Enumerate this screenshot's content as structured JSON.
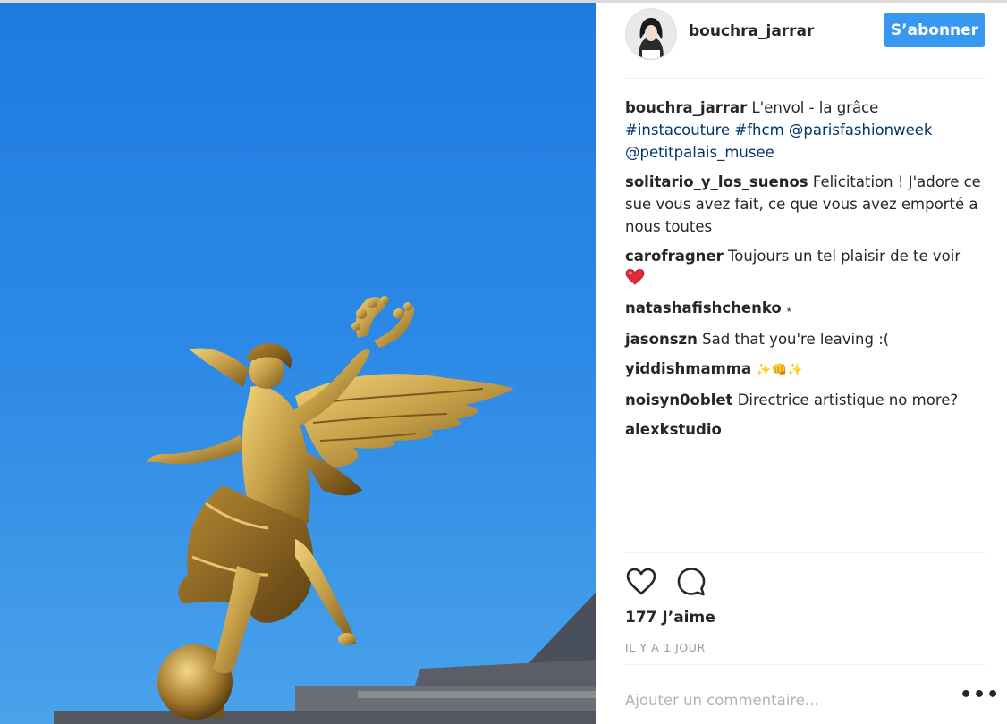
{
  "post": {
    "author": "bouchra_jarrar",
    "follow_label": "S’abonner",
    "caption": {
      "user": "bouchra_jarrar",
      "text": "L'envol - la grâce",
      "tags": [
        "#instacouture",
        "#fhcm",
        "@parisfashionweek",
        "@petitpalais_musee"
      ]
    },
    "comments": [
      {
        "user": "solitario_y_los_suenos",
        "text": "Felicitation ! J'adore ce sue vous avez fait, ce que vous avez emporté a nous toutes"
      },
      {
        "user": "carofragner",
        "text": "Toujours un tel plaisir de te voir"
      },
      {
        "user": "natashafishchenko",
        "text": "⭑"
      },
      {
        "user": "jasonszn",
        "text": "Sad that you're leaving :("
      },
      {
        "user": "yiddishmamma",
        "text": "✨👊✨"
      },
      {
        "user": "noisyn0oblet",
        "text": "Directrice artistique no more?"
      },
      {
        "user": "alexkstudio",
        "text": ""
      }
    ],
    "likes": "177 J’aime",
    "timestamp": "IL Y A 1 JOUR",
    "comment_placeholder": "Ajouter un commentaire...",
    "more_label": "•••"
  },
  "icons": {
    "like": "heart-outline-icon",
    "comment": "speech-bubble-icon",
    "more": "ellipsis-icon",
    "heart_emoji": "red-heart-emoji"
  },
  "colors": {
    "accent": "#3897f0",
    "link": "#003569",
    "text": "#262626",
    "muted": "#999999",
    "sky": "#2d8ae6",
    "gold": "#c9a24a"
  }
}
